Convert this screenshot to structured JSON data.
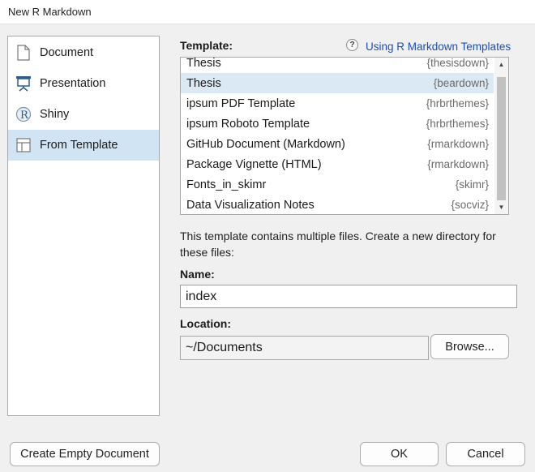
{
  "window": {
    "title": "New R Markdown"
  },
  "sidebar": {
    "items": [
      {
        "label": "Document",
        "icon": "document-icon"
      },
      {
        "label": "Presentation",
        "icon": "presentation-easel-icon"
      },
      {
        "label": "Shiny",
        "icon": "r-logo-icon"
      },
      {
        "label": "From Template",
        "icon": "template-icon",
        "selected": true
      }
    ]
  },
  "template": {
    "label": "Template:",
    "help_link": "Using R Markdown Templates",
    "rows": [
      {
        "name": "Thesis",
        "pkg": "{thesisdown}"
      },
      {
        "name": "Thesis",
        "pkg": "{beardown}",
        "selected": true
      },
      {
        "name": "ipsum PDF Template",
        "pkg": "{hrbrthemes}"
      },
      {
        "name": "ipsum Roboto Template",
        "pkg": "{hrbrthemes}"
      },
      {
        "name": "GitHub Document (Markdown)",
        "pkg": "{rmarkdown}"
      },
      {
        "name": "Package Vignette (HTML)",
        "pkg": "{rmarkdown}"
      },
      {
        "name": "Fonts_in_skimr",
        "pkg": "{skimr}"
      },
      {
        "name": "Data Visualization Notes",
        "pkg": "{socviz}"
      }
    ]
  },
  "description": "This template contains multiple files. Create a new directory for these files:",
  "name_field": {
    "label": "Name:",
    "value": "index"
  },
  "location_field": {
    "label": "Location:",
    "value": "~/Documents",
    "browse_label": "Browse..."
  },
  "footer": {
    "create_empty_label": "Create Empty Document",
    "ok_label": "OK",
    "cancel_label": "Cancel"
  },
  "colors": {
    "selected_sidebar": "#d1e4f3",
    "selected_row": "#dbe9f5",
    "link": "#1c4fb0"
  }
}
